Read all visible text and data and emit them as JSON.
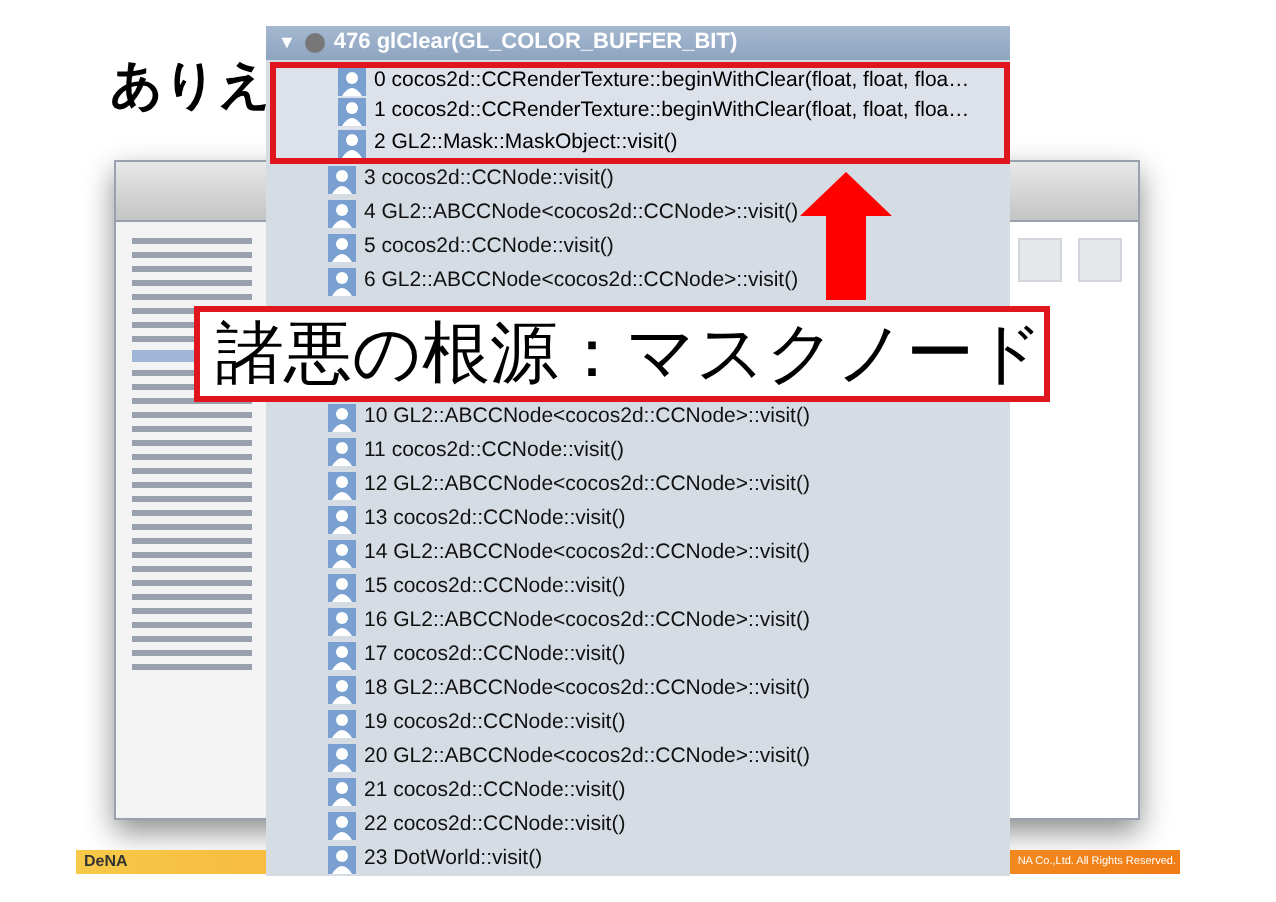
{
  "slide_title": "ありえ",
  "footer": {
    "logo": "DeNA",
    "copyright": "NA Co.,Ltd. All Rights Reserved."
  },
  "call_tree": {
    "header": {
      "toggle": "▼",
      "label": "476 glClear(GL_COLOR_BUFFER_BIT)",
      "expanded": true
    },
    "rows_above": [
      {
        "label": "0 cocos2d::CCRenderTexture::beginWithClear(float, float, floa…",
        "highlighted": true
      },
      {
        "label": "1 cocos2d::CCRenderTexture::beginWithClear(float, float, floa…",
        "highlighted": true
      },
      {
        "label": "2 GL2::Mask::MaskObject::visit()",
        "highlighted": true
      },
      {
        "label": "3 cocos2d::CCNode::visit()",
        "highlighted": false
      },
      {
        "label": "4 GL2::ABCCNode<cocos2d::CCNode>::visit()",
        "highlighted": false
      },
      {
        "label": "5 cocos2d::CCNode::visit()",
        "highlighted": false
      },
      {
        "label": "6 GL2::ABCCNode<cocos2d::CCNode>::visit()",
        "highlighted": false
      }
    ],
    "rows_below": [
      {
        "label": "10 GL2::ABCCNode<cocos2d::CCNode>::visit()",
        "highlighted": false
      },
      {
        "label": "11 cocos2d::CCNode::visit()",
        "highlighted": false
      },
      {
        "label": "12 GL2::ABCCNode<cocos2d::CCNode>::visit()",
        "highlighted": false
      },
      {
        "label": "13 cocos2d::CCNode::visit()",
        "highlighted": false
      },
      {
        "label": "14 GL2::ABCCNode<cocos2d::CCNode>::visit()",
        "highlighted": false
      },
      {
        "label": "15 cocos2d::CCNode::visit()",
        "highlighted": false
      },
      {
        "label": "16 GL2::ABCCNode<cocos2d::CCNode>::visit()",
        "highlighted": false
      },
      {
        "label": "17 cocos2d::CCNode::visit()",
        "highlighted": false
      },
      {
        "label": "18 GL2::ABCCNode<cocos2d::CCNode>::visit()",
        "highlighted": false
      },
      {
        "label": "19 cocos2d::CCNode::visit()",
        "highlighted": false
      },
      {
        "label": "20 GL2::ABCCNode<cocos2d::CCNode>::visit()",
        "highlighted": false
      },
      {
        "label": "21 cocos2d::CCNode::visit()",
        "highlighted": false
      },
      {
        "label": "22 cocos2d::CCNode::visit()",
        "highlighted": false
      },
      {
        "label": "23 DotWorld::visit()",
        "highlighted": false
      }
    ]
  },
  "callout": "諸悪の根源：マスクノード"
}
